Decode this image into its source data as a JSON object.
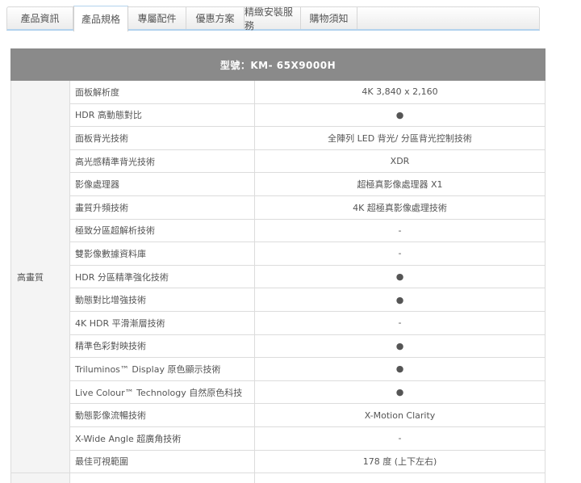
{
  "tabs": [
    {
      "label": "產品資訊"
    },
    {
      "label": "產品規格"
    },
    {
      "label": "專屬配件"
    },
    {
      "label": "優惠方案"
    },
    {
      "label": "精緻安裝服務"
    },
    {
      "label": "購物須知"
    }
  ],
  "active_tab": 1,
  "table": {
    "header": "型號：KM- 65X9000H",
    "category": "高畫質",
    "rows": [
      {
        "name": "面板解析度",
        "value": "4K 3,840 x 2,160"
      },
      {
        "name": "HDR 高動態對比",
        "value": "●"
      },
      {
        "name": "面板背光技術",
        "value": "全陣列 LED 背光/ 分區背光控制技術"
      },
      {
        "name": "高光感精準背光技術",
        "value": "XDR"
      },
      {
        "name": "影像處理器",
        "value": "超極真影像處理器 X1"
      },
      {
        "name": "畫質升頻技術",
        "value": "4K 超極真影像處理技術"
      },
      {
        "name": "極致分區超解析技術",
        "value": "-"
      },
      {
        "name": "雙影像數據資料庫",
        "value": "-"
      },
      {
        "name": "HDR 分區精準強化技術",
        "value": "●"
      },
      {
        "name": "動態對比增強技術",
        "value": "●"
      },
      {
        "name": "4K HDR 平滑漸層技術",
        "value": "-"
      },
      {
        "name": "精準色彩對映技術",
        "value": "●"
      },
      {
        "name": "Triluminos™ Display 原色顯示技術",
        "value": "●"
      },
      {
        "name": "Live Colour™ Technology 自然原色科技",
        "value": "●"
      },
      {
        "name": "動態影像流暢技術",
        "value": "X-Motion Clarity"
      },
      {
        "name": "X-Wide Angle 超廣角技術",
        "value": "-"
      },
      {
        "name": "最佳可視範圍",
        "value": "178 度 (上下左右)"
      }
    ]
  }
}
